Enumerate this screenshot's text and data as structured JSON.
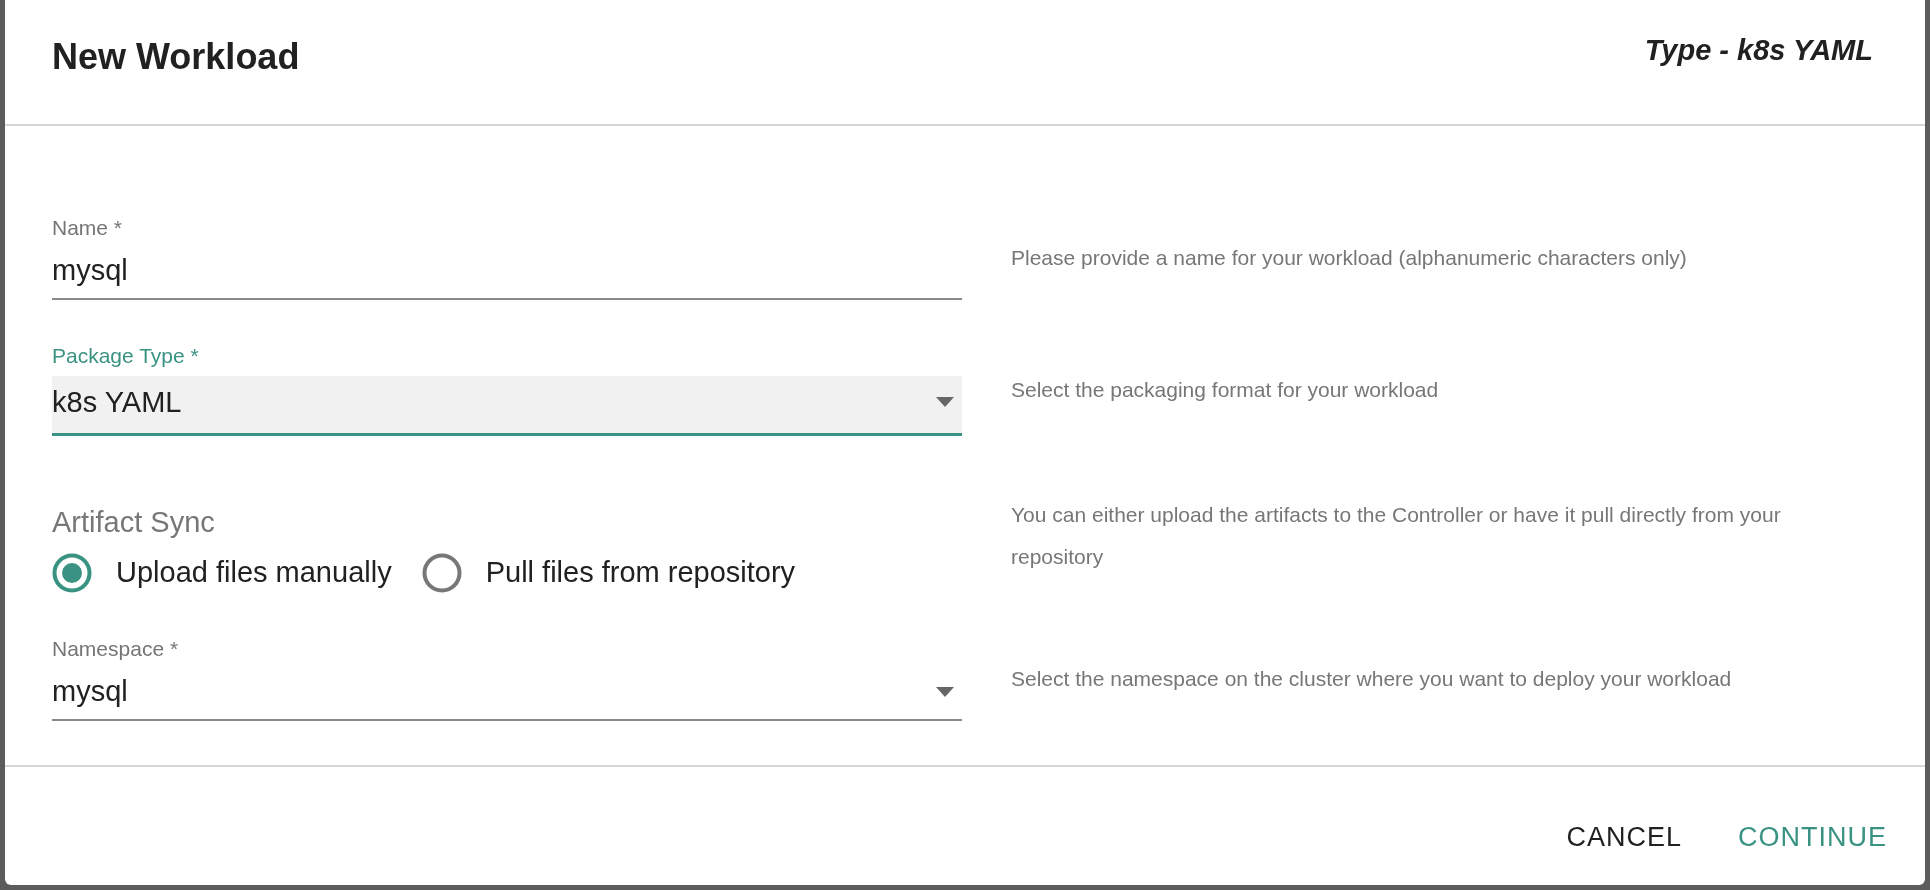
{
  "dialog": {
    "title": "New Workload",
    "subtitle": "Type - k8s YAML"
  },
  "fields": [
    {
      "kind": "text",
      "label": "Name *",
      "value": "mysql",
      "focused": false,
      "help": "Please provide a name for your workload (alphanumeric characters only)"
    },
    {
      "kind": "select",
      "label": "Package Type *",
      "value": "k8s YAML",
      "focused": true,
      "help": "Select the packaging format for your workload"
    },
    {
      "kind": "radio",
      "label": "Artifact Sync",
      "options": [
        {
          "label": "Upload files manually",
          "selected": true
        },
        {
          "label": "Pull files from repository",
          "selected": false
        }
      ],
      "help": "You can either upload the artifacts to the Controller or have it pull directly from your repository"
    },
    {
      "kind": "select",
      "label": "Namespace *",
      "value": "mysql",
      "focused": false,
      "help": "Select the namespace on the cluster where you want to deploy your workload"
    }
  ],
  "buttons": [
    {
      "label": "CANCEL",
      "primary": false
    },
    {
      "label": "CONTINUE",
      "primary": true
    }
  ]
}
